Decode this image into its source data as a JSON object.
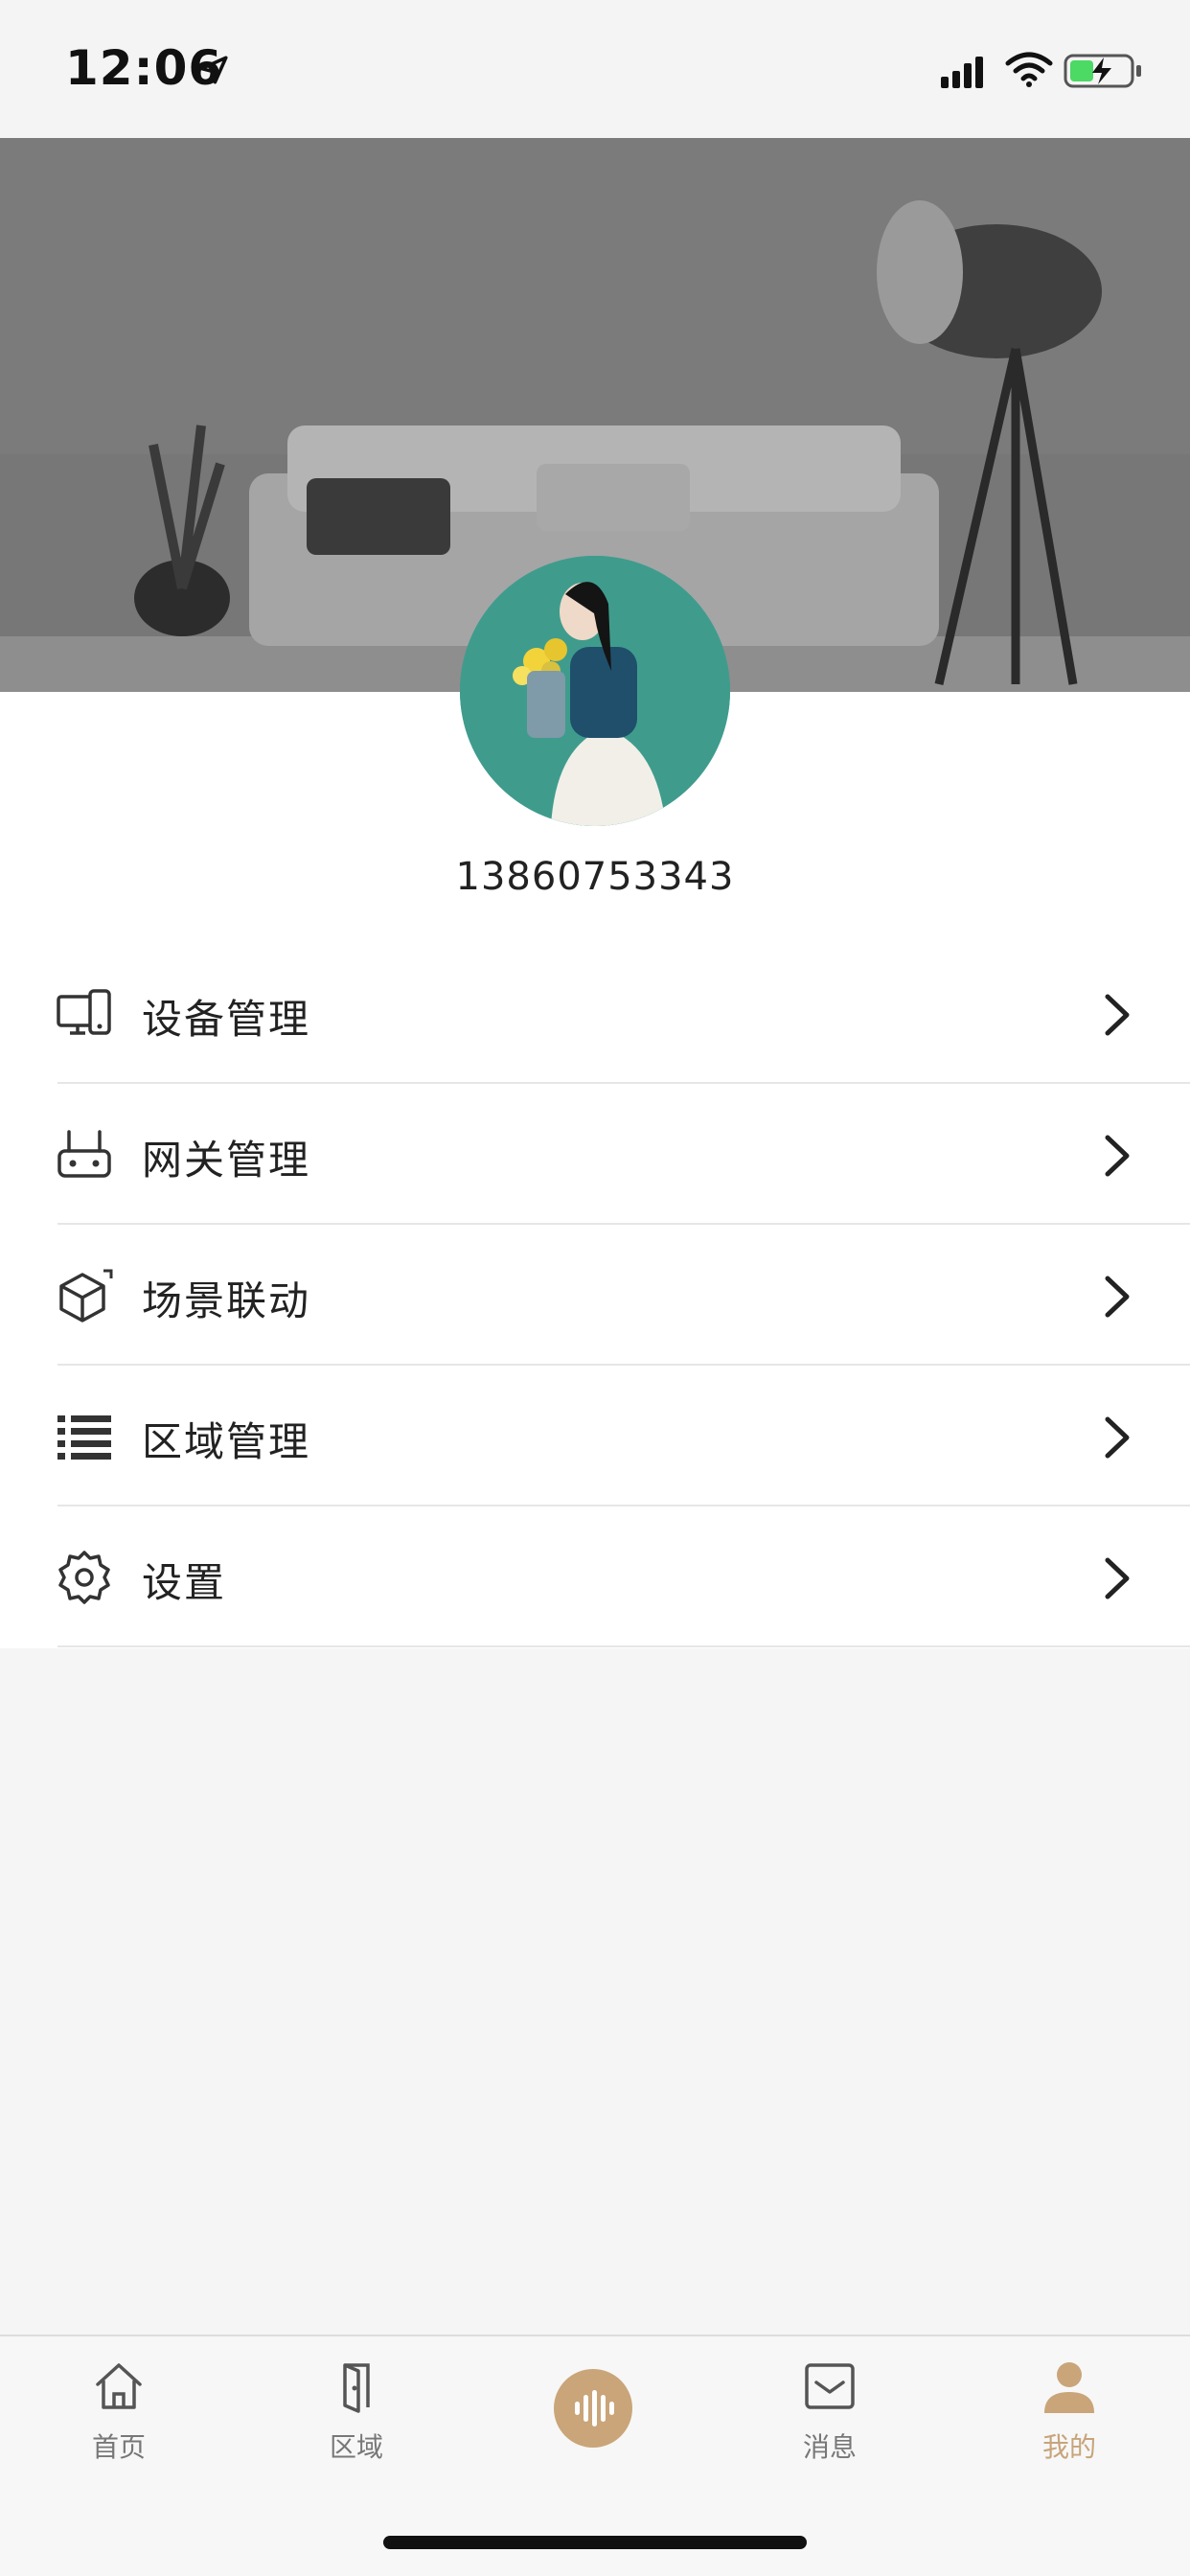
{
  "status_bar": {
    "time": "12:06"
  },
  "profile": {
    "phone": "13860753343"
  },
  "menu": {
    "items": [
      {
        "label": "设备管理",
        "icon": "device-icon"
      },
      {
        "label": "网关管理",
        "icon": "gateway-icon"
      },
      {
        "label": "场景联动",
        "icon": "cube-icon"
      },
      {
        "label": "区域管理",
        "icon": "list-icon"
      },
      {
        "label": "设置",
        "icon": "gear-icon"
      }
    ]
  },
  "tabbar": {
    "items": [
      {
        "label": "首页",
        "icon": "home-icon"
      },
      {
        "label": "区域",
        "icon": "door-icon"
      },
      {
        "label": "",
        "icon": "voice-icon"
      },
      {
        "label": "消息",
        "icon": "message-icon"
      },
      {
        "label": "我的",
        "icon": "user-icon",
        "active": true
      }
    ]
  },
  "colors": {
    "accent": "#c9a579",
    "background": "#f5f5f5",
    "text": "#222222"
  }
}
